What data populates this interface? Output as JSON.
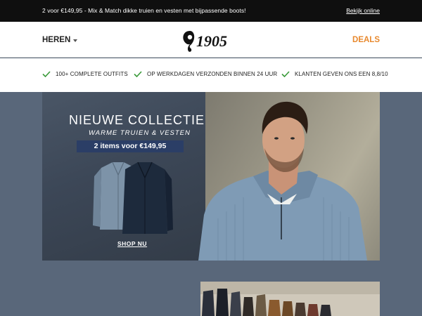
{
  "topbar": {
    "promo": "2 voor €149,95 - Mix & Match dikke truien en vesten met bijpassende boots!",
    "view_online": "Bekijk online"
  },
  "header": {
    "nav_left": "HEREN",
    "logo_text": "1905",
    "nav_right": "DEALS"
  },
  "usps": [
    {
      "icon": "check-icon",
      "label": "100+ COMPLETE OUTFITS"
    },
    {
      "icon": "check-icon",
      "label": "OP WERKDAGEN VERZONDEN BINNEN 24 UUR"
    },
    {
      "icon": "check-icon",
      "label": "KLANTEN GEVEN ONS EEN 8,8/10"
    }
  ],
  "hero": {
    "title": "NIEUWE COLLECTIE",
    "subtitle": "WARME TRUIEN & VESTEN",
    "badge": "2 items voor €149,95",
    "cta": "SHOP NU"
  },
  "colors": {
    "accent": "#e8892e",
    "check": "#3a9a3a",
    "badge": "#2b3e66",
    "background": "#59677a"
  }
}
